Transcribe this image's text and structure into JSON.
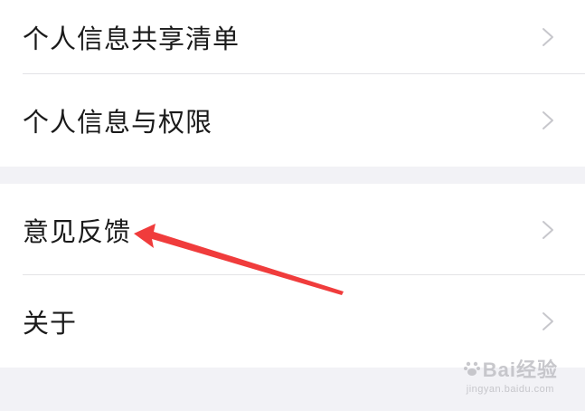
{
  "settings_list": {
    "groups": [
      {
        "items": [
          {
            "label": "个人信息共享清单",
            "chevron_icon": "chevron-right-icon"
          },
          {
            "label": "个人信息与权限",
            "chevron_icon": "chevron-right-icon"
          }
        ]
      },
      {
        "items": [
          {
            "label": "意见反馈",
            "chevron_icon": "chevron-right-icon"
          },
          {
            "label": "关于",
            "chevron_icon": "chevron-right-icon"
          }
        ]
      }
    ]
  },
  "annotation": {
    "arrow_icon": "red-arrow-annotation",
    "color": "#f03c3c"
  },
  "watermark": {
    "main_text": "Bai经验",
    "sub_text": "jingyan.baidu.com"
  },
  "colors": {
    "background": "#f2f2f6",
    "row_background": "#ffffff",
    "text": "#1a1a1a",
    "chevron": "#c7c7cc",
    "divider": "#e3e3e6"
  }
}
